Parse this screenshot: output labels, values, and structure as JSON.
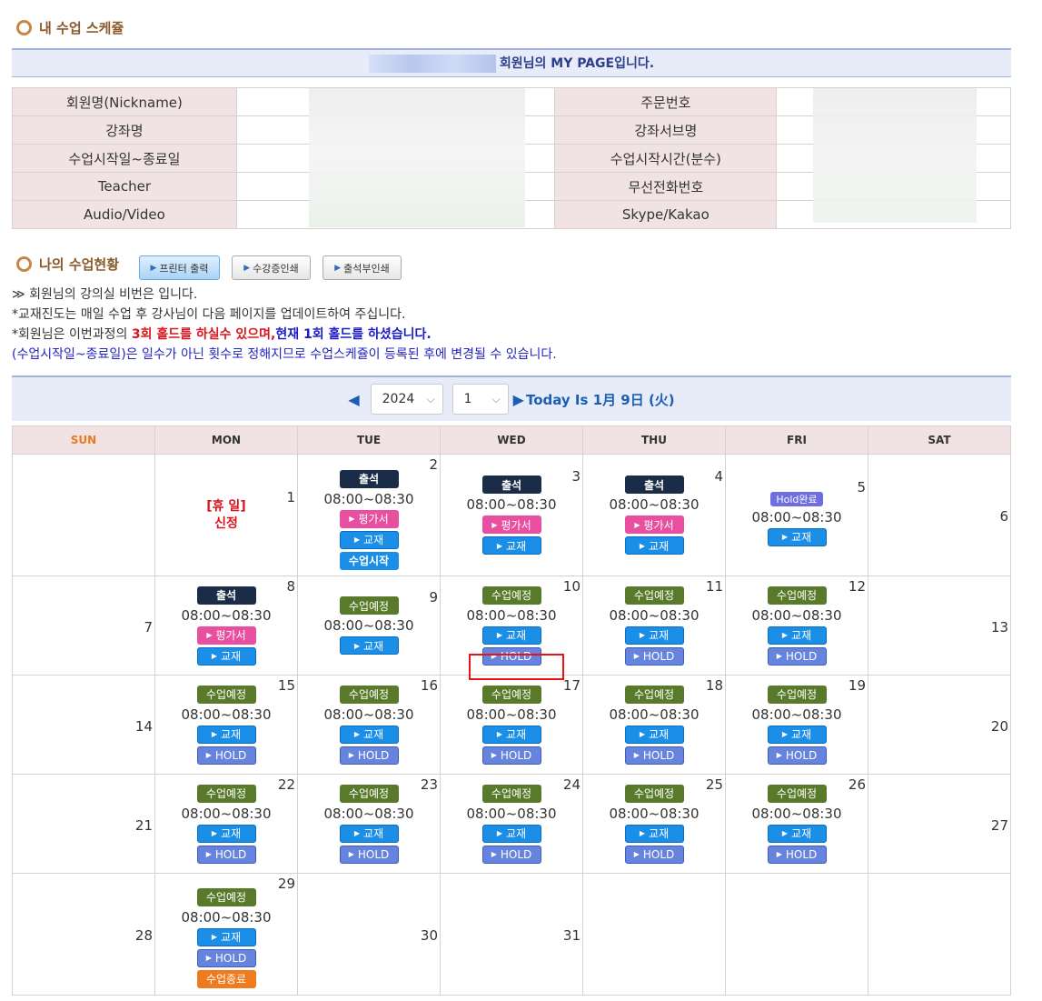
{
  "section1_title": "내 수업 스케쥴",
  "mypage_text": "회원님의 MY PAGE입니다.",
  "info": {
    "left_labels": [
      "회원명(Nickname)",
      "강좌명",
      "수업시작일~종료일",
      "Teacher",
      "Audio/Video"
    ],
    "right_labels": [
      "주문번호",
      "강좌서브명",
      "수업시작시간(분수)",
      "무선전화번호",
      "Skype/Kakao"
    ]
  },
  "section2_title": "나의 수업현황",
  "buttons": [
    "프린터 출력",
    "수강증인쇄",
    "출석부인쇄"
  ],
  "notes": {
    "line1": "≫ 회원님의 강의실 비번은 입니다.",
    "line2": "*교재진도는 매일 수업 후 강사님이 다음 페이지를 업데이트하여 주십니다.",
    "line3_a": "*회원님은 이번과정의 ",
    "line3_b": "3회 홀드를 하실수 있으며,",
    "line3_c": "현재 1회 홀드를 하셨습니다.",
    "line4": "(수업시작일~종료일)은 일수가 아닌 횟수로 정해지므로 수업스케쥴이 등록된 후에 변경될 수 있습니다."
  },
  "nav": {
    "year": "2024",
    "month": "1",
    "today": "Today Is 1月 9日 (火)"
  },
  "weekdays": [
    "SUN",
    "MON",
    "TUE",
    "WED",
    "THU",
    "FRI",
    "SAT"
  ],
  "labels": {
    "attend": "출석",
    "scheduled": "수업예정",
    "eval": "평가서",
    "material": "교재",
    "hold": "HOLD",
    "start": "수업시작",
    "end": "수업종료",
    "hold_done": "Hold완료",
    "time": "08:00~08:30",
    "holiday1": "[휴 일]",
    "holiday2": "신정"
  }
}
